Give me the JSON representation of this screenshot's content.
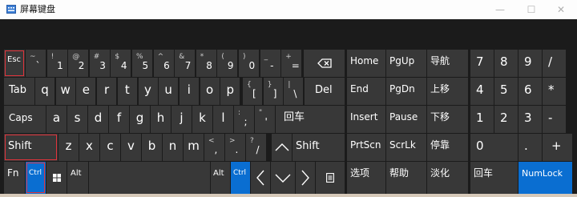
{
  "window": {
    "title": "屏幕键盘",
    "icon": "keyboard-icon",
    "controls": [
      "—",
      "☐",
      "✕"
    ]
  },
  "highlight_color": "#e0333b",
  "accent_color": "#0a6ed1",
  "keys": {
    "esc": "Esc",
    "backspace_icon": "backspace-icon",
    "row1": [
      {
        "top": "~",
        "bot": "`"
      },
      {
        "top": "!",
        "bot": "1"
      },
      {
        "top": "@",
        "bot": "2"
      },
      {
        "top": "#",
        "bot": "3"
      },
      {
        "top": "$",
        "bot": "4"
      },
      {
        "top": "%",
        "bot": "5"
      },
      {
        "top": "^",
        "bot": "6"
      },
      {
        "top": "&",
        "bot": "7"
      },
      {
        "top": "*",
        "bot": "8"
      },
      {
        "top": "(",
        "bot": "9"
      },
      {
        "top": ")",
        "bot": "0"
      },
      {
        "top": "_",
        "bot": "-"
      },
      {
        "top": "+",
        "bot": "="
      }
    ],
    "tab": "Tab",
    "row2_letters": [
      "q",
      "w",
      "e",
      "r",
      "t",
      "y",
      "u",
      "i",
      "o",
      "p"
    ],
    "row2_symbols": [
      {
        "top": "{",
        "bot": "["
      },
      {
        "top": "}",
        "bot": "]"
      },
      {
        "top": "|",
        "bot": "\\"
      }
    ],
    "del": "Del",
    "caps": "Caps",
    "row3_letters": [
      "a",
      "s",
      "d",
      "f",
      "g",
      "h",
      "j",
      "k",
      "l"
    ],
    "row3_symbols": [
      {
        "top": ":",
        "bot": ";"
      },
      {
        "top": "\"",
        "bot": "'"
      }
    ],
    "enter": "回车",
    "shift_left": "Shift",
    "row4_letters": [
      "z",
      "x",
      "c",
      "v",
      "b",
      "n",
      "m"
    ],
    "row4_symbols": [
      {
        "top": "<",
        "bot": ","
      },
      {
        "top": ">",
        "bot": "."
      },
      {
        "top": "?",
        "bot": "/"
      }
    ],
    "up_icon": "chevron-up-icon",
    "shift_right": "Shift",
    "fn": "Fn",
    "ctrl_left": "Ctrl",
    "win_icon": "windows-logo-icon",
    "alt_left": "Alt",
    "alt_right": "Alt",
    "ctrl_right": "Ctrl",
    "left_icon": "chevron-left-icon",
    "down_icon": "chevron-down-icon",
    "right_icon": "chevron-right-icon",
    "menu_icon": "context-menu-icon",
    "nav": [
      "Home",
      "PgUp",
      "导航",
      "End",
      "PgDn",
      "上移",
      "Insert",
      "Pause",
      "下移",
      "PrtScn",
      "ScrLk",
      "停靠",
      "选项",
      "帮助",
      "淡化"
    ],
    "numpad": [
      "7",
      "8",
      "9",
      "/",
      "4",
      "5",
      "6",
      "*",
      "1",
      "2",
      "3",
      "-",
      "0",
      ".",
      "+",
      "回车",
      "NumLock"
    ]
  }
}
